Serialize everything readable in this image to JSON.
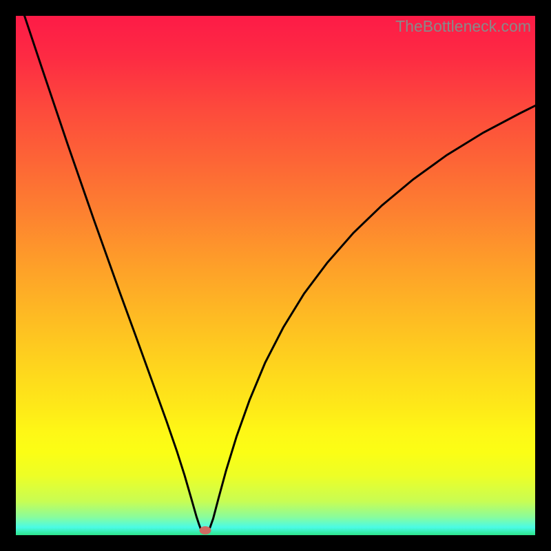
{
  "watermark": "TheBottleneck.com",
  "gradient_stops": [
    {
      "offset": 0.0,
      "color": "#fd1b47"
    },
    {
      "offset": 0.08,
      "color": "#fd2b43"
    },
    {
      "offset": 0.18,
      "color": "#fd4a3c"
    },
    {
      "offset": 0.28,
      "color": "#fd6536"
    },
    {
      "offset": 0.38,
      "color": "#fd8130"
    },
    {
      "offset": 0.48,
      "color": "#fe9f29"
    },
    {
      "offset": 0.58,
      "color": "#febb23"
    },
    {
      "offset": 0.68,
      "color": "#fed61d"
    },
    {
      "offset": 0.75,
      "color": "#fee819"
    },
    {
      "offset": 0.8,
      "color": "#fef716"
    },
    {
      "offset": 0.84,
      "color": "#fbfe15"
    },
    {
      "offset": 0.885,
      "color": "#edfe26"
    },
    {
      "offset": 0.935,
      "color": "#c8fd53"
    },
    {
      "offset": 0.965,
      "color": "#8afc9b"
    },
    {
      "offset": 0.985,
      "color": "#4afbe6"
    },
    {
      "offset": 1.0,
      "color": "#2ce48b"
    }
  ],
  "marker": {
    "x_frac": 0.365,
    "y_frac": 0.991
  },
  "curve_left": [
    {
      "x": 0.0,
      "y": -0.05
    },
    {
      "x": 0.05,
      "y": 0.1
    },
    {
      "x": 0.1,
      "y": 0.248
    },
    {
      "x": 0.15,
      "y": 0.392
    },
    {
      "x": 0.2,
      "y": 0.532
    },
    {
      "x": 0.23,
      "y": 0.614
    },
    {
      "x": 0.26,
      "y": 0.697
    },
    {
      "x": 0.29,
      "y": 0.78
    },
    {
      "x": 0.31,
      "y": 0.838
    },
    {
      "x": 0.325,
      "y": 0.885
    },
    {
      "x": 0.338,
      "y": 0.93
    },
    {
      "x": 0.348,
      "y": 0.965
    },
    {
      "x": 0.353,
      "y": 0.98
    },
    {
      "x": 0.356,
      "y": 0.988
    },
    {
      "x": 0.36,
      "y": 0.991
    }
  ],
  "curve_right": [
    {
      "x": 0.37,
      "y": 0.991
    },
    {
      "x": 0.374,
      "y": 0.985
    },
    {
      "x": 0.38,
      "y": 0.968
    },
    {
      "x": 0.39,
      "y": 0.93
    },
    {
      "x": 0.405,
      "y": 0.875
    },
    {
      "x": 0.425,
      "y": 0.81
    },
    {
      "x": 0.45,
      "y": 0.74
    },
    {
      "x": 0.48,
      "y": 0.668
    },
    {
      "x": 0.515,
      "y": 0.6
    },
    {
      "x": 0.555,
      "y": 0.535
    },
    {
      "x": 0.6,
      "y": 0.475
    },
    {
      "x": 0.65,
      "y": 0.418
    },
    {
      "x": 0.705,
      "y": 0.365
    },
    {
      "x": 0.765,
      "y": 0.315
    },
    {
      "x": 0.83,
      "y": 0.268
    },
    {
      "x": 0.9,
      "y": 0.225
    },
    {
      "x": 0.97,
      "y": 0.188
    },
    {
      "x": 1.0,
      "y": 0.173
    }
  ],
  "chart_data": {
    "type": "line",
    "title": "",
    "xlabel": "",
    "ylabel": "",
    "xlim": [
      0,
      1
    ],
    "ylim": [
      0,
      1
    ],
    "note": "Bottleneck-style V-curve; axes unlabeled in source image; values are fractional plot coordinates estimated from pixels.",
    "series": [
      {
        "name": "left-branch",
        "x": [
          0.0,
          0.05,
          0.1,
          0.15,
          0.2,
          0.23,
          0.26,
          0.29,
          0.31,
          0.325,
          0.338,
          0.348,
          0.353,
          0.356,
          0.36
        ],
        "y": [
          1.05,
          0.9,
          0.752,
          0.608,
          0.468,
          0.386,
          0.303,
          0.22,
          0.162,
          0.115,
          0.07,
          0.035,
          0.02,
          0.012,
          0.009
        ]
      },
      {
        "name": "right-branch",
        "x": [
          0.37,
          0.374,
          0.38,
          0.39,
          0.405,
          0.425,
          0.45,
          0.48,
          0.515,
          0.555,
          0.6,
          0.65,
          0.705,
          0.765,
          0.83,
          0.9,
          0.97,
          1.0
        ],
        "y": [
          0.009,
          0.015,
          0.032,
          0.07,
          0.125,
          0.19,
          0.26,
          0.332,
          0.4,
          0.465,
          0.525,
          0.582,
          0.635,
          0.685,
          0.732,
          0.775,
          0.812,
          0.827
        ]
      }
    ],
    "marker": {
      "x": 0.365,
      "y": 0.009,
      "color": "#cf6b62"
    },
    "background_gradient": "vertical red→orange→yellow→green"
  }
}
